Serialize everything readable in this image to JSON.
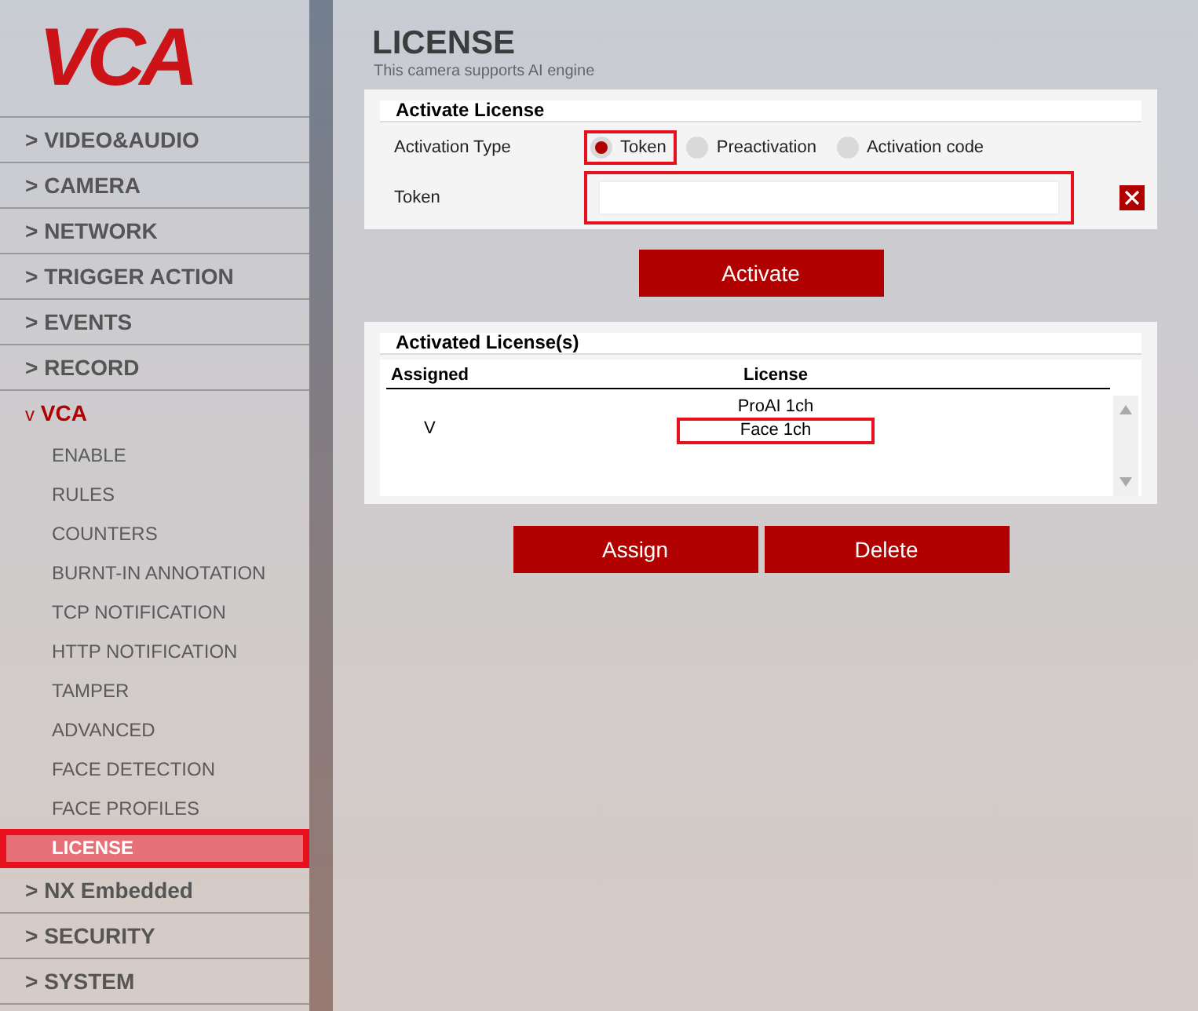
{
  "logo": {
    "text": "VCA"
  },
  "sidebar": {
    "items": [
      {
        "marker": ">",
        "label": "VIDEO&AUDIO",
        "expanded": false
      },
      {
        "marker": ">",
        "label": "CAMERA",
        "expanded": false
      },
      {
        "marker": ">",
        "label": "NETWORK",
        "expanded": false
      },
      {
        "marker": ">",
        "label": "TRIGGER ACTION",
        "expanded": false
      },
      {
        "marker": ">",
        "label": "EVENTS",
        "expanded": false
      },
      {
        "marker": ">",
        "label": "RECORD",
        "expanded": false
      },
      {
        "marker": "v",
        "label": "VCA",
        "expanded": true,
        "children": [
          {
            "label": "ENABLE",
            "selected": false,
            "highlighted": false
          },
          {
            "label": "RULES",
            "selected": false,
            "highlighted": false
          },
          {
            "label": "COUNTERS",
            "selected": false,
            "highlighted": false
          },
          {
            "label": "BURNT-IN ANNOTATION",
            "selected": false,
            "highlighted": false
          },
          {
            "label": "TCP NOTIFICATION",
            "selected": false,
            "highlighted": false
          },
          {
            "label": "HTTP NOTIFICATION",
            "selected": false,
            "highlighted": false
          },
          {
            "label": "TAMPER",
            "selected": false,
            "highlighted": false
          },
          {
            "label": "ADVANCED",
            "selected": false,
            "highlighted": false
          },
          {
            "label": "FACE DETECTION",
            "selected": false,
            "highlighted": false
          },
          {
            "label": "FACE PROFILES",
            "selected": false,
            "highlighted": false
          },
          {
            "label": "LICENSE",
            "selected": true,
            "highlighted": true
          }
        ]
      },
      {
        "marker": ">",
        "label": "NX Embedded",
        "expanded": false
      },
      {
        "marker": ">",
        "label": "SECURITY",
        "expanded": false
      },
      {
        "marker": ">",
        "label": "SYSTEM",
        "expanded": false
      }
    ]
  },
  "page": {
    "title": "LICENSE",
    "subtitle": "This camera supports AI engine"
  },
  "activate_panel": {
    "title": "Activate License",
    "type_label": "Activation Type",
    "options": [
      {
        "label": "Token",
        "selected": true,
        "highlighted": true
      },
      {
        "label": "Preactivation",
        "selected": false,
        "highlighted": false
      },
      {
        "label": "Activation code",
        "selected": false,
        "highlighted": false
      }
    ],
    "token_label": "Token",
    "token_field": {
      "highlighted": true
    },
    "button": "Activate"
  },
  "licenses_panel": {
    "title": "Activated License(s)",
    "columns": [
      "Assigned",
      "License"
    ],
    "rows": [
      {
        "license": "ProAI 1ch",
        "highlighted": false
      },
      {
        "assigned": "V",
        "license": "Face 1ch",
        "highlighted": true
      }
    ]
  },
  "buttons": [
    "Assign",
    "Delete"
  ]
}
